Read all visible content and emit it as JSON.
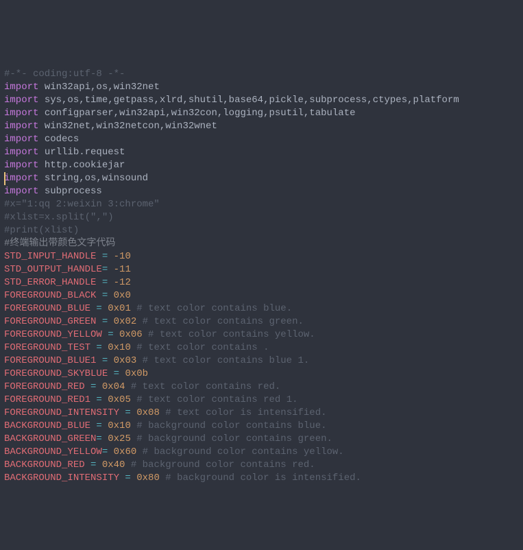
{
  "lines": {
    "l0": "#-*- coding:utf-8 -*-",
    "l1_kw": "import",
    "l1_rest": " win32api,os,win32net",
    "l2_kw": "import",
    "l2_rest": " sys,os,time,getpass,xlrd,shutil,base64,pickle,subprocess,ctypes,platform",
    "l3_kw": "import",
    "l3_rest": " configparser,win32api,win32con,logging,psutil,tabulate",
    "l4_kw": "import",
    "l4_rest": " win32net,win32netcon,win32wnet",
    "l5_kw": "import",
    "l5_rest": " codecs",
    "blank": "",
    "l7_kw": "import",
    "l7_rest": " urllib.request",
    "l8_kw": "import",
    "l8_rest": " http.cookiejar",
    "l9_kw": "import",
    "l9_rest": " string,os,winsound",
    "l10_kw": "import",
    "l10_rest": " subprocess",
    "l13": "#x=\"1:qq 2:weixin 3:chrome\"",
    "l14": "#xlist=x.split(\",\")",
    "l15": "#print(xlist)",
    "l17": "#终端输出带颜色文字代码",
    "a1_name": "STD_INPUT_HANDLE",
    "a1_eq": " = ",
    "a1_val": "-10",
    "a2_name": "STD_OUTPUT_HANDLE",
    "a2_eq": "= ",
    "a2_val": "-11",
    "a3_name": "STD_ERROR_HANDLE",
    "a3_eq": " = ",
    "a3_val": "-12",
    "a4_name": "FOREGROUND_BLACK",
    "a4_eq": " = ",
    "a4_val": "0x0",
    "a5_name": "FOREGROUND_BLUE",
    "a5_eq": " = ",
    "a5_val": "0x01",
    "a5_c": " # text color contains blue.",
    "a6_name": "FOREGROUND_GREEN",
    "a6_eq": " = ",
    "a6_val": "0x02",
    "a6_c": " # text color contains green.",
    "a7_name": "FOREGROUND_YELLOW",
    "a7_eq": " = ",
    "a7_val": "0x06",
    "a7_c": " # text color contains yellow.",
    "a8_name": "FOREGROUND_TEST",
    "a8_eq": " = ",
    "a8_val": "0x10",
    "a8_c": " # text color contains .",
    "a9_name": "FOREGROUND_BLUE1",
    "a9_eq": " = ",
    "a9_val": "0x03",
    "a9_c": " # text color contains blue 1.",
    "a10_name": "FOREGROUND_SKYBLUE",
    "a10_eq": " = ",
    "a10_val": "0x0b",
    "a11_name": "FOREGROUND_RED",
    "a11_eq": " = ",
    "a11_val": "0x04",
    "a11_c": " # text color contains red.",
    "a12_name": "FOREGROUND_RED1",
    "a12_eq": " = ",
    "a12_val": "0x05",
    "a12_c": " # text color contains red 1.",
    "a13_name": "FOREGROUND_INTENSITY",
    "a13_eq": " = ",
    "a13_val": "0x08",
    "a13_c": " # text color is intensified.",
    "a14_name": "BACKGROUND_BLUE",
    "a14_eq": " = ",
    "a14_val": "0x10",
    "a14_c": " # background color contains blue.",
    "a15_name": "BACKGROUND_GREEN",
    "a15_eq": "= ",
    "a15_val": "0x25",
    "a15_c": " # background color contains green.",
    "a16_name": "BACKGROUND_YELLOW",
    "a16_eq": "= ",
    "a16_val": "0x60",
    "a16_c": " # background color contains yellow.",
    "a17_name": "BACKGROUND_RED",
    "a17_eq": " = ",
    "a17_val": "0x40",
    "a17_c": " # background color contains red.",
    "a18_name": "BACKGROUND_INTENSITY",
    "a18_eq": " = ",
    "a18_val": "0x80",
    "a18_c": " # background color is intensified."
  }
}
